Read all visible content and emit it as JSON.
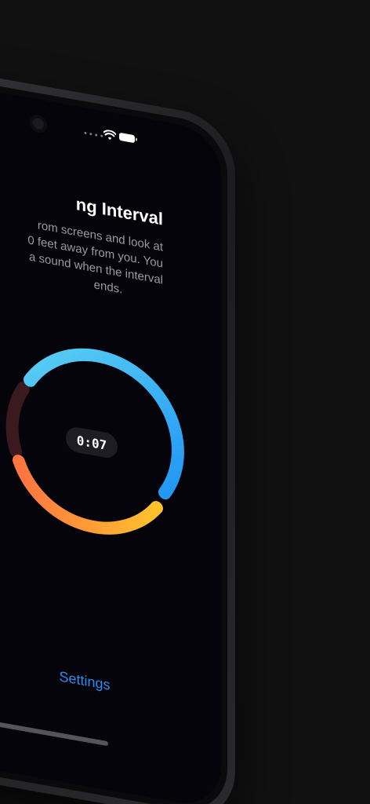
{
  "status_bar": {
    "signal_icon": "signal-dots-icon",
    "wifi_icon": "wifi-icon",
    "battery_icon": "battery-icon"
  },
  "screen": {
    "title": "ng Interval",
    "description_lines": [
      "rom screens and look at",
      "0 feet away from you. You",
      "a sound when the interval",
      "ends."
    ]
  },
  "timer": {
    "value": "0:07",
    "ring_colors": [
      "#4fc3f7",
      "#2196f3",
      "#ffb02e",
      "#ff7a45",
      "#3a1a1e"
    ]
  },
  "footer": {
    "settings_label": "Settings",
    "settings_color": "#2f8cf2"
  }
}
